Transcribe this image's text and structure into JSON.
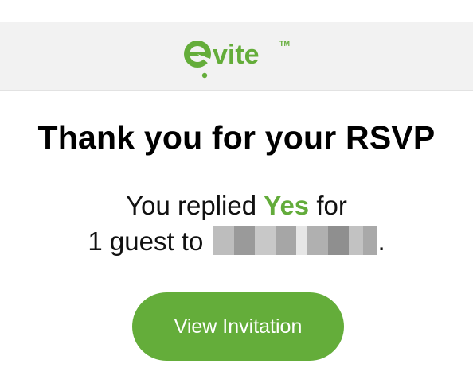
{
  "brand": {
    "logo_text": "evite",
    "trademark": "TM",
    "accent_color": "#64ad3a"
  },
  "header": {
    "title": "Thank you for your RSVP"
  },
  "message": {
    "line1_prefix": "You replied ",
    "response": "Yes",
    "line1_suffix": " for",
    "line2_prefix": "1 guest to ",
    "event_name_redacted": true,
    "line2_suffix": "."
  },
  "actions": {
    "view_invitation_label": "View Invitation"
  }
}
